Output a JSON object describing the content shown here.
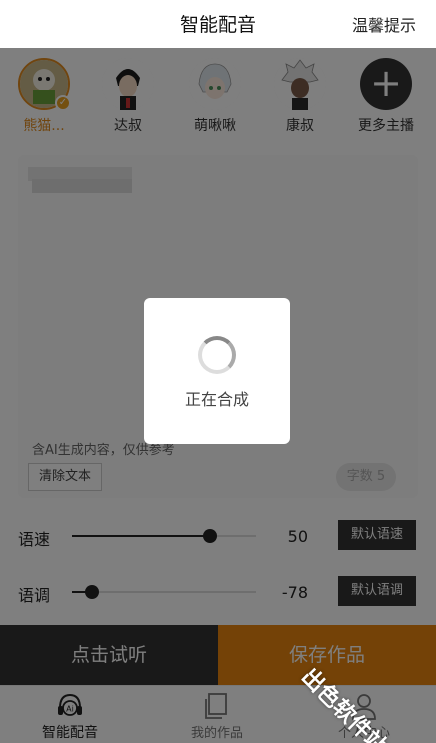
{
  "header": {
    "title": "智能配音",
    "tips": "温馨提示"
  },
  "anchors": [
    {
      "name": "熊猫...",
      "selected": true
    },
    {
      "name": "达叔",
      "selected": false
    },
    {
      "name": "萌啾啾",
      "selected": false
    },
    {
      "name": "康叔",
      "selected": false
    }
  ],
  "more_anchors": {
    "label": "更多主播",
    "icon": "plus-icon"
  },
  "editor": {
    "ai_note": "含AI生成内容，仅供参考",
    "clear_label": "清除文本",
    "char_count": "字数 5"
  },
  "speed": {
    "label": "语速",
    "value": "50",
    "level": 0.75,
    "default_label": "默认语速"
  },
  "pitch": {
    "label": "语调",
    "value": "-78",
    "level": 0.11,
    "default_label": "默认语调"
  },
  "actions": {
    "try_label": "点击试听",
    "save_label": "保存作品"
  },
  "tabs": [
    {
      "label": "智能配音",
      "icon": "ai-headset-icon",
      "active": true
    },
    {
      "label": "我的作品",
      "icon": "works-icon",
      "active": false
    },
    {
      "label": "个人中心",
      "icon": "user-icon",
      "active": false
    }
  ],
  "dialog": {
    "message": "正在合成"
  },
  "watermark": "出色软件站",
  "colors": {
    "accent": "#e8850f",
    "dark": "#333333",
    "selected_text": "#e08a1e"
  }
}
